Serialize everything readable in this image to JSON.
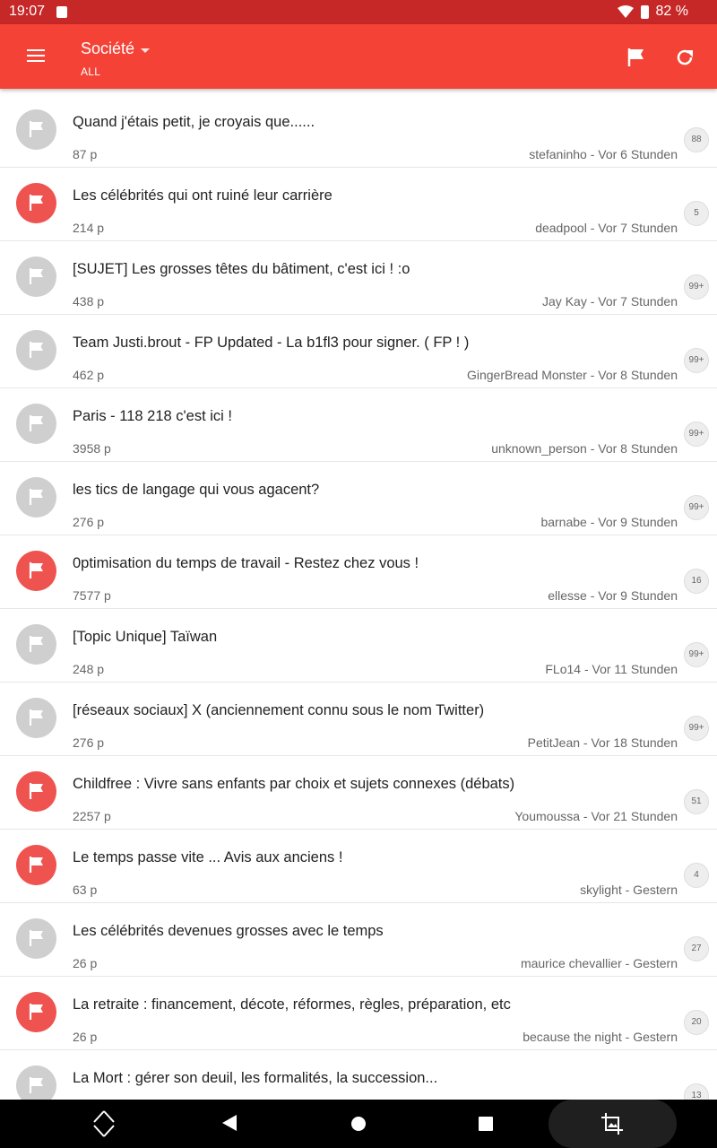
{
  "status_bar": {
    "time": "19:07",
    "battery": "82 %"
  },
  "app_bar": {
    "title": "Société",
    "subtitle": "ALL"
  },
  "topics": [
    {
      "title": "Quand j'étais petit, je croyais que......",
      "pages": "87 p",
      "meta": "stefaninho - Vor 6 Stunden",
      "badge": "88",
      "flag": "grey"
    },
    {
      "title": "Les célébrités qui ont ruiné leur carrière",
      "pages": "214 p",
      "meta": "deadpool - Vor 7 Stunden",
      "badge": "5",
      "flag": "red"
    },
    {
      "title": "[SUJET] Les grosses têtes du bâtiment, c'est ici ! :o",
      "pages": "438 p",
      "meta": "Jay Kay - Vor 7 Stunden",
      "badge": "99+",
      "flag": "grey"
    },
    {
      "title": "Team Justi.brout - FP Updated - La b1fl3 pour signer. ( FP ! )",
      "pages": "462 p",
      "meta": "GingerBread Monster - Vor 8 Stunden",
      "badge": "99+",
      "flag": "grey"
    },
    {
      "title": "Paris - 118 218 c'est ici !",
      "pages": "3958 p",
      "meta": "unknown_person - Vor 8 Stunden",
      "badge": "99+",
      "flag": "grey"
    },
    {
      "title": "les tics de langage qui vous agacent?",
      "pages": "276 p",
      "meta": "barnabe - Vor 9 Stunden",
      "badge": "99+",
      "flag": "grey"
    },
    {
      "title": "0ptimisation du temps de travail - Restez chez vous !",
      "pages": "7577 p",
      "meta": "ellesse - Vor 9 Stunden",
      "badge": "16",
      "flag": "red"
    },
    {
      "title": "[Topic Unique] Taïwan",
      "pages": "248 p",
      "meta": "FLo14 - Vor 11 Stunden",
      "badge": "99+",
      "flag": "grey"
    },
    {
      "title": "[réseaux sociaux] X (anciennement connu sous le nom Twitter)",
      "pages": "276 p",
      "meta": "PetitJean - Vor 18 Stunden",
      "badge": "99+",
      "flag": "grey"
    },
    {
      "title": "Childfree : Vivre sans enfants par choix et sujets connexes (débats)",
      "pages": "2257 p",
      "meta": "Youmoussa - Vor 21 Stunden",
      "badge": "51",
      "flag": "red"
    },
    {
      "title": "Le temps passe vite ... Avis aux anciens !",
      "pages": "63 p",
      "meta": "skylight - Gestern",
      "badge": "4",
      "flag": "red"
    },
    {
      "title": "Les célébrités devenues grosses avec le temps",
      "pages": "26 p",
      "meta": "maurice chevallier - Gestern",
      "badge": "27",
      "flag": "grey"
    },
    {
      "title": "La retraite : financement, décote, réformes, règles, préparation, etc",
      "pages": "26 p",
      "meta": "because the night - Gestern",
      "badge": "20",
      "flag": "red"
    },
    {
      "title": "La Mort : gérer son deuil, les formalités, la succession...",
      "pages": "",
      "meta": "",
      "badge": "13",
      "flag": "grey"
    }
  ],
  "colors": {
    "status_bar": "#c62828",
    "app_bar": "#f44336",
    "flag_red": "#ef5350",
    "flag_grey": "#cfcfcf"
  },
  "icons": [
    "menu-icon",
    "dropdown-caret-icon",
    "flag-icon",
    "refresh-icon",
    "rotate-icon",
    "back-icon",
    "home-icon",
    "recents-icon",
    "screenshot-icon"
  ]
}
